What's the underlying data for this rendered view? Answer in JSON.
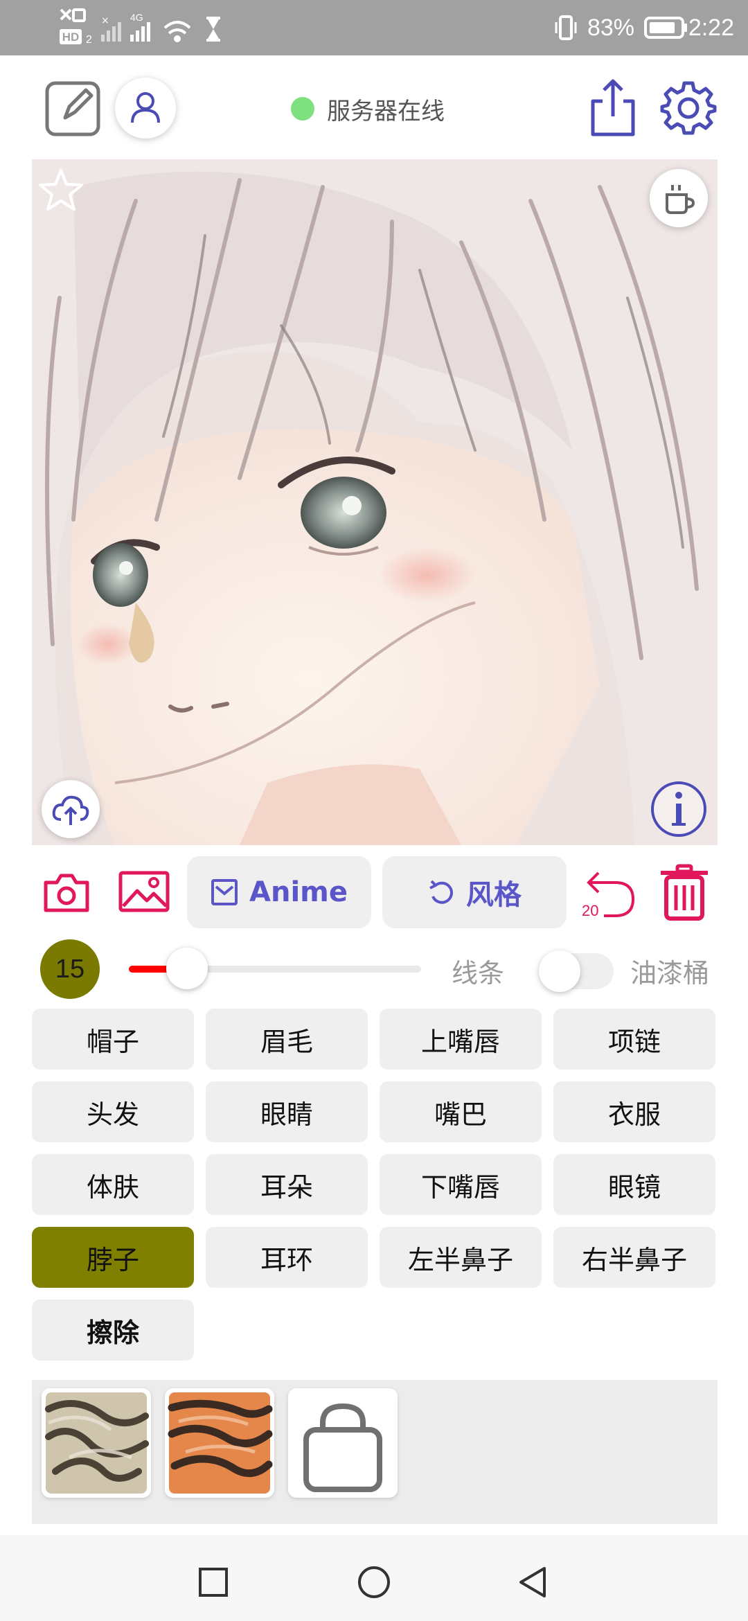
{
  "status_bar": {
    "network_hd": "HD",
    "network_4g": "4G",
    "battery_percent": "83%",
    "time": "2:22",
    "icons": [
      "no-sim-icon",
      "signal-icon",
      "wifi-icon",
      "hourglass-icon",
      "vibrate-icon",
      "battery-icon"
    ]
  },
  "top_bar": {
    "server_status": "服务器在线",
    "server_status_color": "#7fe07f",
    "icons": [
      "edit-icon",
      "user-icon",
      "share-icon",
      "settings-icon"
    ]
  },
  "artwork": {
    "icons": [
      "star-icon",
      "coffee-icon",
      "cloud-upload-icon",
      "info-icon"
    ]
  },
  "toolbar": {
    "anime_label": "Anime",
    "style_label": "风格",
    "undo_count": "20",
    "accent_color": "#e0175c",
    "brand_color": "#5a55c8"
  },
  "brush": {
    "size": "15",
    "slider_level": 0.2,
    "line_label": "线条",
    "bucket_label": "油漆桶",
    "bucket_enabled": false
  },
  "parts": [
    "帽子",
    "眉毛",
    "上嘴唇",
    "项链",
    "头发",
    "眼睛",
    "嘴巴",
    "衣服",
    "体肤",
    "耳朵",
    "下嘴唇",
    "眼镜",
    "脖子",
    "耳环",
    "左半鼻子",
    "右半鼻子",
    "擦除"
  ],
  "selected_part": "脖子",
  "selected_color": "#7f7f00",
  "textures": {
    "icons": [
      "texture-zebra-icon",
      "texture-tiger-icon",
      "shopping-bag-icon"
    ]
  },
  "nav_bar": {
    "icons": [
      "recents-icon",
      "home-icon",
      "back-icon"
    ]
  }
}
